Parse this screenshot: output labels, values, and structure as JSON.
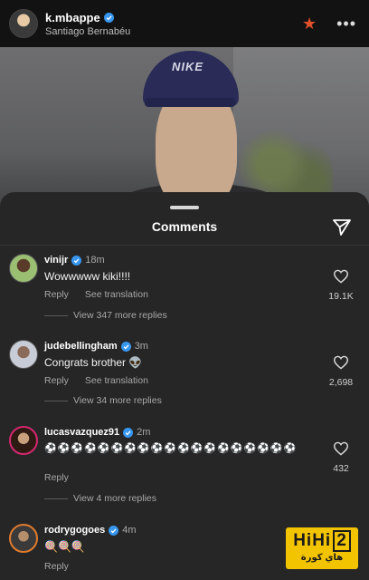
{
  "header": {
    "username": "k.mbappe",
    "location": "Santiago Bernabéu",
    "star_icon": "star-icon",
    "more_icon": "more-options-icon"
  },
  "photo": {
    "cap_logo": "NIKE"
  },
  "sheet": {
    "title": "Comments",
    "share_icon": "send-icon"
  },
  "comments": [
    {
      "username": "vinijr",
      "time": "18m",
      "text": "Wowwwww kiki!!!!",
      "reply_label": "Reply",
      "translate_label": "See translation",
      "replies_label": "View 347 more replies",
      "likes": "19.1K"
    },
    {
      "username": "judebellingham",
      "time": "3m",
      "text": "Congrats brother 👽",
      "reply_label": "Reply",
      "translate_label": "See translation",
      "replies_label": "View 34 more replies",
      "likes": "2,698"
    },
    {
      "username": "lucasvazquez91",
      "time": "2m",
      "text": "⚽⚽⚽⚽⚽⚽⚽⚽⚽⚽⚽⚽⚽⚽⚽⚽⚽⚽⚽",
      "reply_label": "Reply",
      "replies_label": "View 4 more replies",
      "likes": "432"
    },
    {
      "username": "rodrygogoes",
      "time": "4m",
      "text": "🍭🍭🍭",
      "reply_label": "Reply"
    }
  ],
  "watermark": {
    "brand": "HiHi",
    "number": "2",
    "subtitle": "هاي كورة"
  },
  "colors": {
    "sheet_bg": "#262626",
    "verified_blue": "#3797f0",
    "star": "#e0502b",
    "watermark": "#f2c400"
  }
}
